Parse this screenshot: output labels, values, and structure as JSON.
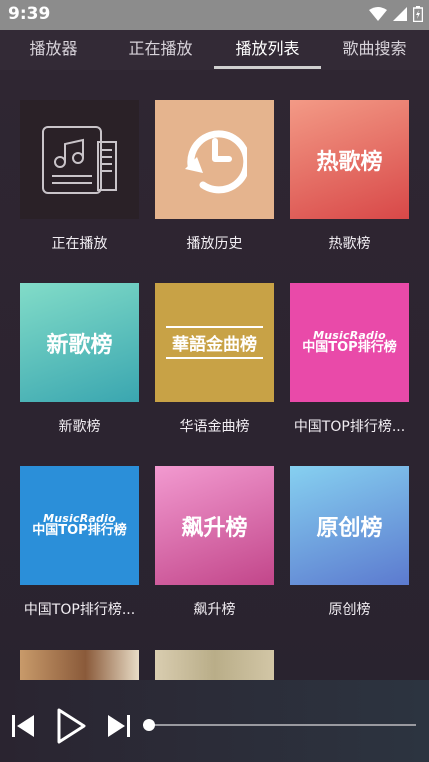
{
  "status": {
    "time": "9:39"
  },
  "tabs": [
    {
      "label": "播放器"
    },
    {
      "label": "正在播放"
    },
    {
      "label": "播放列表"
    },
    {
      "label": "歌曲搜索"
    }
  ],
  "active_tab": 2,
  "playlists": [
    {
      "title": "正在播放",
      "cover_type": "now-playing"
    },
    {
      "title": "播放历史",
      "cover_type": "history"
    },
    {
      "title": "热歌榜",
      "cover_text": "热歌榜"
    },
    {
      "title": "新歌榜",
      "cover_text": "新歌榜"
    },
    {
      "title": "华语金曲榜",
      "cover_text": "華語金曲榜"
    },
    {
      "title": "中国TOP排行榜...",
      "cover_line1": "MusicRadio",
      "cover_line2": "中国TOP排行榜"
    },
    {
      "title": "中国TOP排行榜...",
      "cover_line1": "MusicRadio",
      "cover_line2": "中国TOP排行榜"
    },
    {
      "title": "飙升榜",
      "cover_text": "飙升榜"
    },
    {
      "title": "原创榜",
      "cover_text": "原创榜"
    }
  ],
  "player": {
    "progress": 0.0
  },
  "colors": {
    "history": "#e5b48e",
    "hot_from": "#f08c7c",
    "hot_to": "#d8484a",
    "new_from": "#7fd9c6",
    "new_to": "#3aa9b0",
    "gold": "#c8a246",
    "top_pink": "#e94aa9",
    "top_blue": "#2b8fd9",
    "rise_from": "#f093c8",
    "rise_to": "#c44b8b",
    "orig_from": "#7fc7ee",
    "orig_to": "#5d7ed0"
  }
}
